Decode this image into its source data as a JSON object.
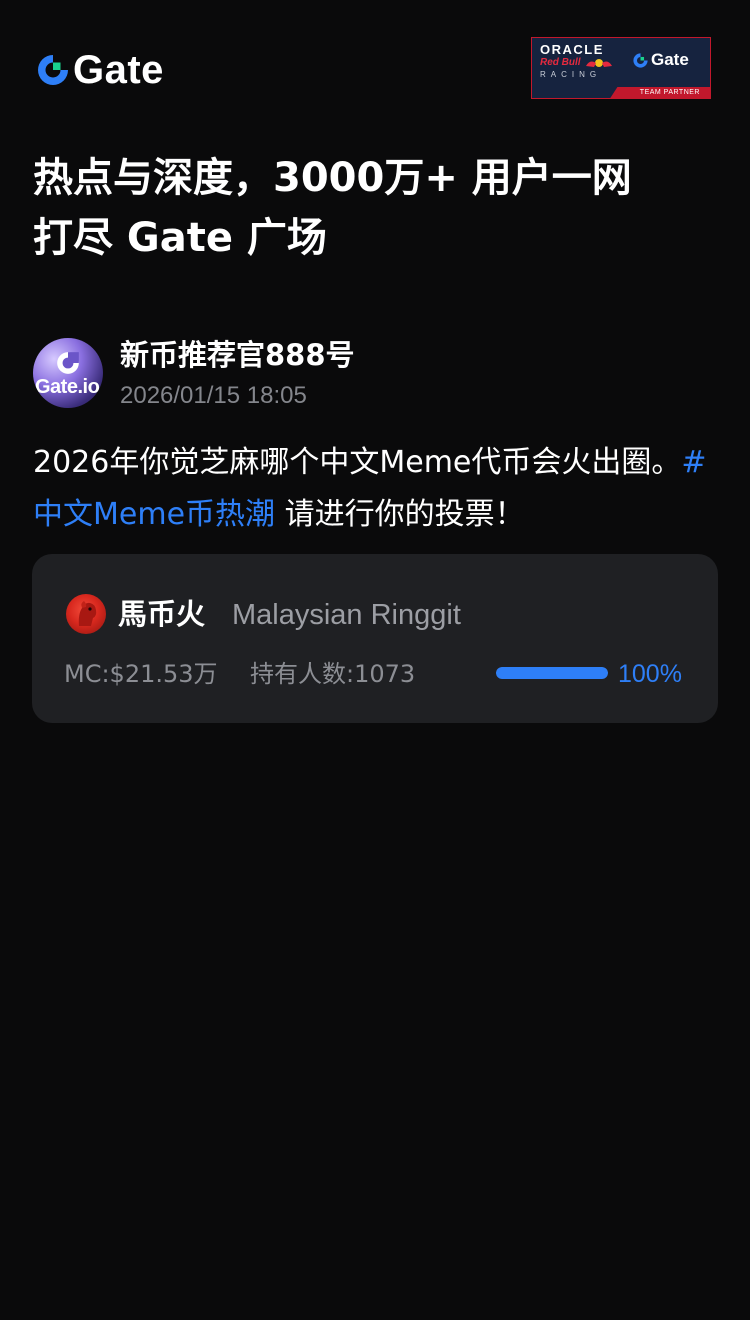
{
  "header": {
    "logo_text": "Gate",
    "logo_icon": "gate-logo-icon",
    "partner": {
      "line1": "ORACLE",
      "line2": "Red Bull",
      "line3": "RACING",
      "brand": "Gate",
      "tag": "TEAM PARTNER"
    }
  },
  "hero": {
    "title_line1": "热点与深度，3000万+ 用户一网",
    "title_line2": "打尽 Gate 广场"
  },
  "post": {
    "author": {
      "name": "新币推荐官888号",
      "avatar_text": "Gate.io",
      "time": "2026/01/15 18:05"
    },
    "text_before": "2026年你觉芝麻哪个中文Meme代币会火出圈。",
    "hashtag": "#中文Meme币热潮",
    "text_after": " 请进行你的投票！",
    "coin": {
      "name": "馬币火",
      "full_name": "Malaysian Ringgit",
      "market_cap": "MC:$21.53万",
      "holders": "持有人数:1073",
      "vote_percent": "100%",
      "vote_fraction": 1.0
    }
  },
  "colors": {
    "background": "#0a0a0b",
    "card": "#1f2023",
    "accent": "#2e7ff7",
    "muted": "#84868c",
    "partner_red": "#c2182c",
    "partner_navy": "#16233f"
  }
}
